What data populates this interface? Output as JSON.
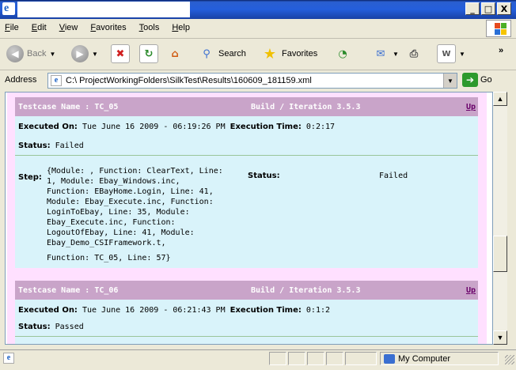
{
  "window": {
    "minimize": "_",
    "maximize": "□",
    "close": "X"
  },
  "menu": [
    "File",
    "Edit",
    "View",
    "Favorites",
    "Tools",
    "Help"
  ],
  "toolbar": {
    "back": "Back",
    "search": "Search",
    "favorites": "Favorites"
  },
  "address": {
    "label": "Address",
    "value": "C:\\      ProjectWorkingFolders\\SilkTest\\Results\\160609_181159.xml",
    "go": "Go"
  },
  "testcases": [
    {
      "name": "Testcase Name : TC_05",
      "build": "Build / Iteration 3.5.3",
      "up": "Up",
      "executed_label": "Executed On:",
      "executed_value": "Tue June 16 2009 - 06:19:26 PM",
      "time_label": "Execution Time:",
      "time_value": "0:2:17",
      "status_label": "Status:",
      "status_value": "Failed",
      "step_label": "Step:",
      "step_lines": [
        "{Module: , Function: ClearText, Line:",
        "1, Module: Ebay_Windows.inc,",
        "Function: EBayHome.Login, Line: 41,",
        "Module: Ebay_Execute.inc, Function:",
        "LoginToEbay, Line: 35, Module:",
        "Ebay_Execute.inc, Function:",
        "LogoutOfEbay, Line: 41, Module:",
        "Ebay_Demo_CSIFramework.t,",
        "Function: TC_05, Line: 57}"
      ],
      "step_status_label": "Status:",
      "step_status_value": "Failed"
    },
    {
      "name": "Testcase Name : TC_06",
      "build": "Build / Iteration 3.5.3",
      "up": "Up",
      "executed_label": "Executed On:",
      "executed_value": "Tue June 16 2009 - 06:21:43 PM",
      "time_label": "Execution Time:",
      "time_value": "0:1:2",
      "status_label": "Status:",
      "status_value": "Passed"
    }
  ],
  "statusbar": {
    "zone": "My Computer"
  }
}
